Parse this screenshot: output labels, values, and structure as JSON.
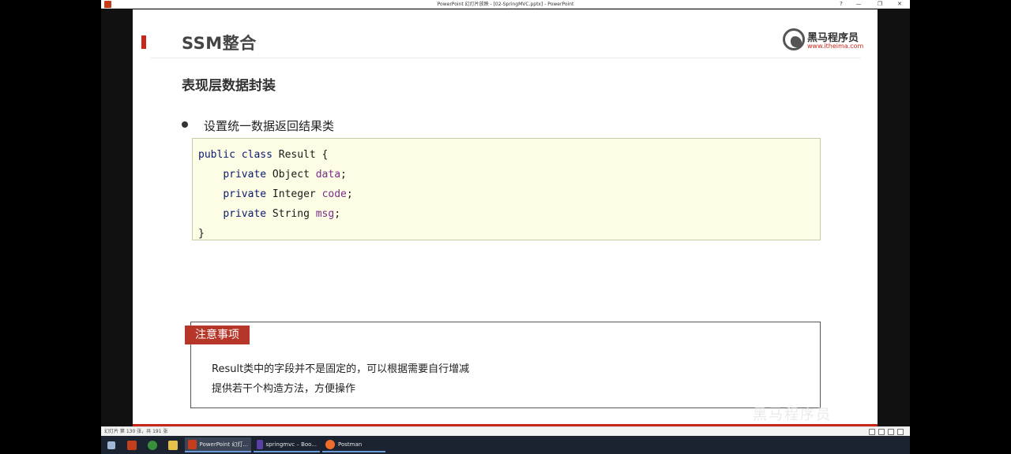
{
  "window": {
    "title": "PowerPoint 幻灯片放映 - [02-SpringMVC.pptx] - PowerPoint",
    "controls": [
      "?",
      "—",
      "❐",
      "✕"
    ]
  },
  "slide": {
    "title": "SSM整合",
    "logo": {
      "name": "黑马程序员",
      "url": "www.itheima.com"
    },
    "section_heading": "表现层数据封装",
    "bullet": "设置统一数据返回结果类",
    "code": {
      "line1": {
        "kw": "public class",
        "rest": " Result {"
      },
      "line2": {
        "kw": "private",
        "type": " Object ",
        "field": "data",
        "end": ";"
      },
      "line3": {
        "kw": "private",
        "type": " Integer ",
        "field": "code",
        "end": ";"
      },
      "line4": {
        "kw": "private",
        "type": " String ",
        "field": "msg",
        "end": ";"
      },
      "line5": "}"
    },
    "note": {
      "tag": "注意事项",
      "line1": "Result类中的字段并不是固定的，可以根据需要自行增减",
      "line2": "提供若干个构造方法，方便操作"
    },
    "watermark": "黑马程序员"
  },
  "statusbar": {
    "text": "幻灯片 第 130 张，共 191 张"
  },
  "taskbar": {
    "apps": [
      {
        "label": "PowerPoint 幻灯..."
      },
      {
        "label": "springmvc – Boo..."
      },
      {
        "label": "Postman"
      }
    ]
  },
  "colors": {
    "accent": "#c8261b",
    "code_bg": "#fdfde6",
    "note_tag": "#b6372a",
    "keyword": "#0b1a6e",
    "field": "#7a2e8a"
  }
}
